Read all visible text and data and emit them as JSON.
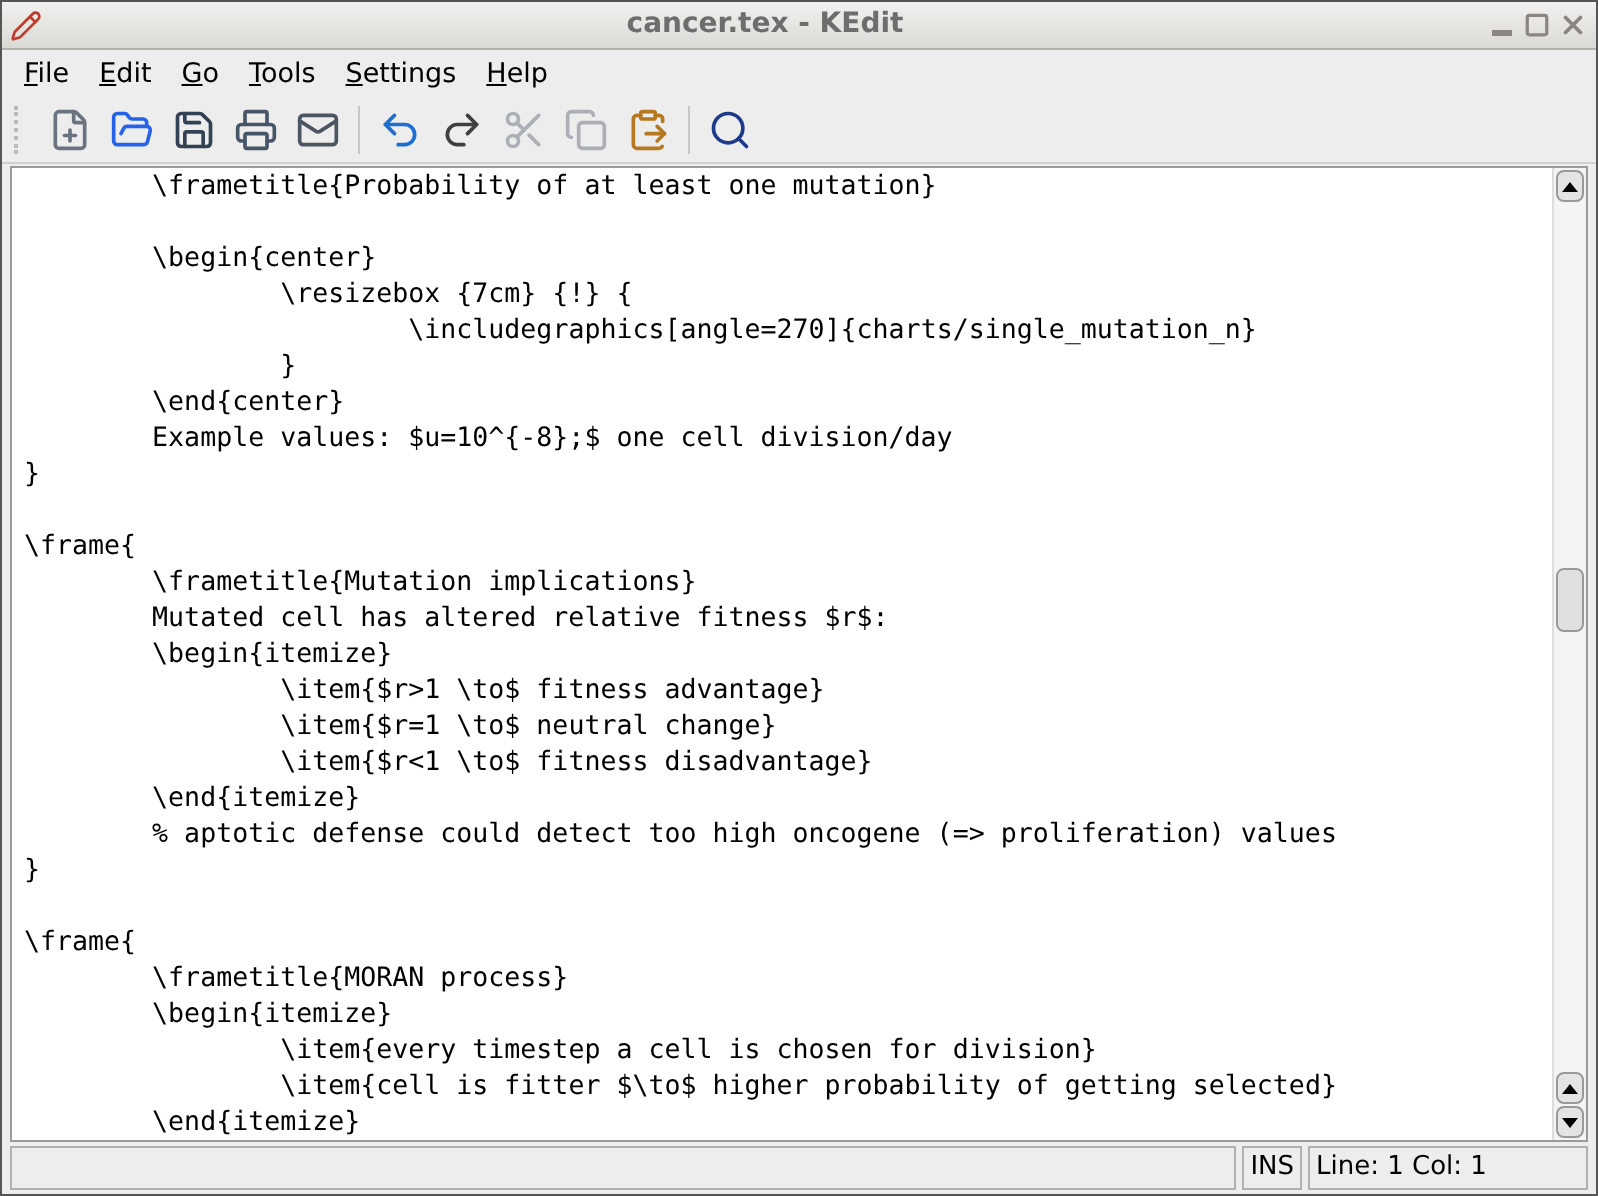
{
  "window": {
    "title": "cancer.tex - KEdit"
  },
  "menu": [
    {
      "label": "File"
    },
    {
      "label": "Edit"
    },
    {
      "label": "Go"
    },
    {
      "label": "Tools"
    },
    {
      "label": "Settings"
    },
    {
      "label": "Help"
    }
  ],
  "toolbar": [
    {
      "kind": "new"
    },
    {
      "kind": "open"
    },
    {
      "kind": "save"
    },
    {
      "kind": "print"
    },
    {
      "kind": "mail"
    },
    {
      "kind": "separator"
    },
    {
      "kind": "undo"
    },
    {
      "kind": "redo"
    },
    {
      "kind": "cut",
      "disabled": true
    },
    {
      "kind": "copy",
      "disabled": true
    },
    {
      "kind": "paste"
    },
    {
      "kind": "separator"
    },
    {
      "kind": "find"
    }
  ],
  "editor": {
    "lines": [
      {
        "text": "\t\\frametitle{Probability of at least one mutation}"
      },
      {
        "kind": "blank"
      },
      {
        "text": "\t\\begin{center}"
      },
      {
        "text": "\t\t\\resizebox {7cm} {!} {"
      },
      {
        "text": "\t\t\t\\includegraphics[angle=270]{charts/single_mutation_n}"
      },
      {
        "text": "\t\t}"
      },
      {
        "text": "\t\\end{center}"
      },
      {
        "text": "\tExample values: $u=10^{-8};$ one cell division/day"
      },
      {
        "text": "}"
      },
      {
        "kind": "blank"
      },
      {
        "text": "\\frame{"
      },
      {
        "text": "\t\\frametitle{Mutation implications}"
      },
      {
        "text": "\tMutated cell has altered relative fitness $r$:"
      },
      {
        "text": "\t\\begin{itemize}"
      },
      {
        "text": "\t\t\\item{$r>1 \\to$ fitness advantage}"
      },
      {
        "text": "\t\t\\item{$r=1 \\to$ neutral change}"
      },
      {
        "text": "\t\t\\item{$r<1 \\to$ fitness disadvantage}"
      },
      {
        "text": "\t\\end{itemize}"
      },
      {
        "text": "\t% aptotic defense could detect too high oncogene (=> proliferation) values"
      },
      {
        "text": "}"
      },
      {
        "kind": "blank"
      },
      {
        "text": "\\frame{"
      },
      {
        "text": "\t\\frametitle{MORAN process}"
      },
      {
        "text": "\t\\begin{itemize}"
      },
      {
        "text": "\t\t\\item{every timestep a cell is chosen for division}"
      },
      {
        "text": "\t\t\\item{cell is fitter $\\to$ higher probability of getting selected}"
      },
      {
        "text": "\t\\end{itemize}"
      }
    ]
  },
  "status_bar": {
    "mode": "INS",
    "position": "Line: 1 Col: 1"
  }
}
